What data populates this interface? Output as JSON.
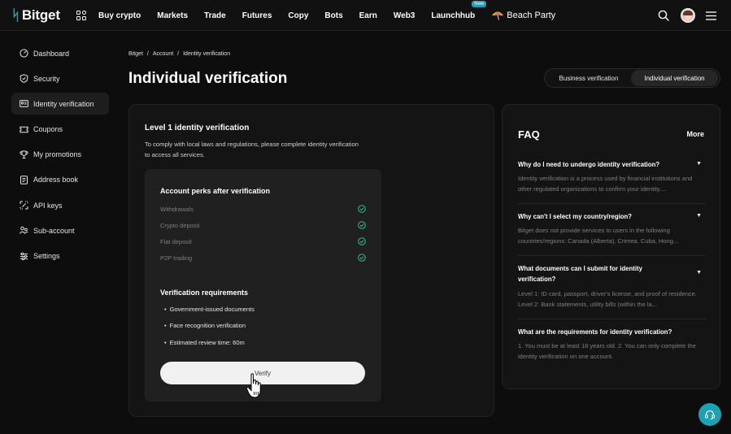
{
  "topnav": {
    "logo": "Bitget",
    "items": [
      "Buy crypto",
      "Markets",
      "Trade",
      "Futures",
      "Copy",
      "Bots",
      "Earn",
      "Web3",
      "Launchhub"
    ],
    "launchhub_badge": "New",
    "beach_party": "Beach Party",
    "icons": [
      "apps-icon",
      "umbrella-icon",
      "search-icon",
      "avatar",
      "menu-icon"
    ]
  },
  "sidebar": {
    "items": [
      {
        "label": "Dashboard",
        "icon": "dashboard-icon"
      },
      {
        "label": "Security",
        "icon": "shield-icon"
      },
      {
        "label": "Identity verification",
        "icon": "id-card-icon",
        "active": true
      },
      {
        "label": "Coupons",
        "icon": "coupon-icon"
      },
      {
        "label": "My promotions",
        "icon": "trophy-icon"
      },
      {
        "label": "Address book",
        "icon": "address-book-icon"
      },
      {
        "label": "API keys",
        "icon": "api-icon"
      },
      {
        "label": "Sub-account",
        "icon": "sub-account-icon"
      },
      {
        "label": "Settings",
        "icon": "settings-icon"
      }
    ]
  },
  "breadcrumb": [
    "Bitget",
    "Account",
    "Identity verification"
  ],
  "page_title": "Individual verification",
  "verification_toggle": {
    "business": "Business verification",
    "individual": "Individual verification",
    "selected": "individual"
  },
  "level1": {
    "title": "Level 1 identity verification",
    "description": "To comply with local laws and regulations, please complete identity verification to access all services.",
    "perks_title": "Account perks after verification",
    "perks": [
      "Withdrawals",
      "Crypto deposit",
      "Fiat deposit",
      "P2P trading"
    ],
    "requirements_title": "Verification requirements",
    "requirements": [
      "Government-issued documents",
      "Face recognition verification",
      "Estimated review time: 60m"
    ],
    "verify_label": "Verify"
  },
  "faq": {
    "title": "FAQ",
    "more": "More",
    "items": [
      {
        "q": "Why do I need to undergo identity verification?",
        "a": "Identity verification is a process used by financial institutions and other regulated organizations to confirm your identity...."
      },
      {
        "q": "Why can't I select my country/region?",
        "a": "Bitget does not provide services to users in the following countries/regions: Canada (Alberta), Crimea, Cuba, Hong..."
      },
      {
        "q": "What documents can I submit for identity verification?",
        "a": "Level 1: ID card, passport, driver's license, and proof of residence. Level 2: Bank statements, utility bills (within the la..."
      },
      {
        "q": "What are the requirements for identity verification?",
        "a": "1. You must be at least 18 years old. 2. You can only complete the identity verification on one account."
      }
    ]
  },
  "colors": {
    "brand": "#1da2b4",
    "check": "#2ebd85",
    "background": "#0d0d0d"
  }
}
